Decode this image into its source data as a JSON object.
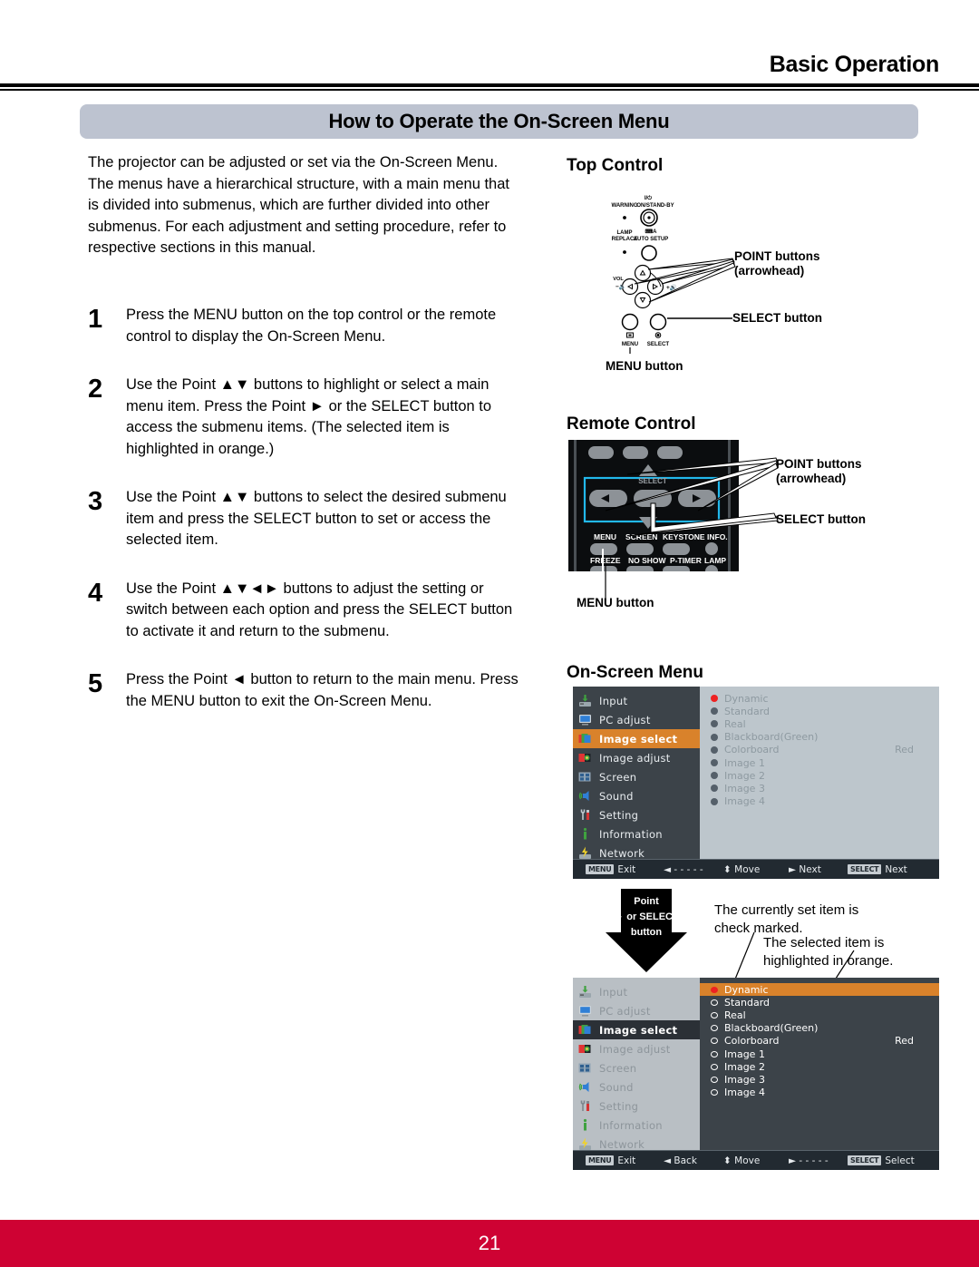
{
  "header": {
    "chapter_title": "Basic Operation",
    "section_title": "How to Operate the On-Screen Menu"
  },
  "intro": {
    "paragraph": "The projector can be adjusted or set via the On-Screen Menu. The menus have a hierarchical structure, with a main menu that is divided into submenus, which are further divided into other submenus. For each adjustment and setting procedure, refer to respective sections in this manual."
  },
  "steps": [
    {
      "number": "1",
      "text": "Press the MENU button on the top control or the remote control to display the On-Screen Menu."
    },
    {
      "number": "2",
      "text": "Use the Point ▲▼ buttons to highlight or select a main menu item. Press the Point ► or the SELECT button to access the submenu items. (The selected item is highlighted in orange.)"
    },
    {
      "number": "3",
      "text": "Use the Point ▲▼ buttons to select the desired submenu item and press the SELECT button to set or access the selected item."
    },
    {
      "number": "4",
      "text": "Use the Point ▲▼◄► buttons to adjust the setting or switch between each option and press the SELECT button to activate it and return to the submenu."
    },
    {
      "number": "5",
      "text": "Press the Point ◄ button to return to the main menu. Press the MENU button to exit the On-Screen Menu."
    }
  ],
  "top_control": {
    "heading": "Top Control",
    "labels": {
      "warning": "WARNING",
      "on_standby_symbol": "I/⏻",
      "on_standby": "ON/STAND-BY",
      "lamp_replace_line1": "LAMP",
      "lamp_replace_line2": "REPLACE",
      "auto_setup": "AUTO SETUP",
      "vol": "VOL",
      "menu": "MENU",
      "select": "SELECT"
    },
    "callouts": {
      "point_line1": "POINT buttons",
      "point_line2": "(arrowhead)",
      "select": "SELECT button",
      "menu": "MENU button"
    }
  },
  "remote_control": {
    "heading": "Remote Control",
    "button_row_1": [
      "MENU",
      "SCREEN",
      "KEYSTONE",
      "INFO."
    ],
    "button_row_2": [
      "FREEZE",
      "NO SHOW",
      "P-TIMER",
      "LAMP"
    ],
    "select_label": "SELECT",
    "callouts": {
      "point_line1": "POINT buttons",
      "point_line2": "(arrowhead)",
      "select": "SELECT button",
      "menu": "MENU button"
    }
  },
  "on_screen_menu": {
    "heading": "On-Screen Menu",
    "main_menu_items": [
      {
        "label": "Input",
        "icon": "input-icon"
      },
      {
        "label": "PC adjust",
        "icon": "monitor-icon"
      },
      {
        "label": "Image select",
        "icon": "image-select-icon"
      },
      {
        "label": "Image adjust",
        "icon": "image-adjust-icon"
      },
      {
        "label": "Screen",
        "icon": "screen-icon"
      },
      {
        "label": "Sound",
        "icon": "speaker-icon"
      },
      {
        "label": "Setting",
        "icon": "tools-icon"
      },
      {
        "label": "Information",
        "icon": "info-icon"
      },
      {
        "label": "Network",
        "icon": "network-icon"
      }
    ],
    "selected_main_item": "Image select",
    "submenu_options": [
      {
        "label": "Dynamic",
        "value": ""
      },
      {
        "label": "Standard",
        "value": ""
      },
      {
        "label": "Real",
        "value": ""
      },
      {
        "label": "Blackboard(Green)",
        "value": ""
      },
      {
        "label": "Colorboard",
        "value": "Red"
      },
      {
        "label": "Image 1",
        "value": ""
      },
      {
        "label": "Image 2",
        "value": ""
      },
      {
        "label": "Image 3",
        "value": ""
      },
      {
        "label": "Image 4",
        "value": ""
      }
    ],
    "checked_option": "Dynamic",
    "highlighted_option": "Dynamic",
    "menu1_status_bar": [
      {
        "key": "MENU",
        "label": "Exit"
      },
      {
        "key": "",
        "label": "◄ - - - - -"
      },
      {
        "key": "",
        "label": "⬍ Move"
      },
      {
        "key": "",
        "label": "► Next"
      },
      {
        "key": "SELECT",
        "label": "Next"
      }
    ],
    "menu2_status_bar": [
      {
        "key": "MENU",
        "label": "Exit"
      },
      {
        "key": "",
        "label": "◄ Back"
      },
      {
        "key": "",
        "label": "⬍ Move"
      },
      {
        "key": "",
        "label": "► - - - - -"
      },
      {
        "key": "SELECT",
        "label": "Select"
      }
    ],
    "transition_arrow": {
      "line1": "Point",
      "line2": "► or SELECT",
      "line3": "button"
    },
    "annotations": {
      "checked": "The currently set item is\ncheck marked.",
      "highlighted": "The selected item is\nhighlighted in orange."
    }
  },
  "footer": {
    "page_number": "21"
  },
  "colors": {
    "footer_red": "#ce0233",
    "section_bar": "#bdc3d0",
    "osd_orange": "#d9822b",
    "osd_dark": "#3c4349",
    "osd_light": "#bdc6cc",
    "osd_bar": "#222a31"
  }
}
